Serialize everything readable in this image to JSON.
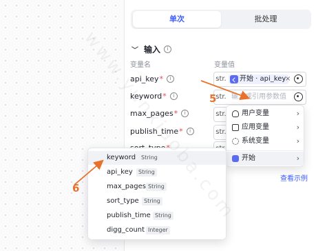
{
  "tabs": [
    {
      "label": "单次"
    },
    {
      "label": "批处理"
    }
  ],
  "section": {
    "title": "输入"
  },
  "columns": {
    "name": "变量名",
    "value": "变量值"
  },
  "rows": [
    {
      "name": "api_key",
      "required": "*",
      "type": "str.",
      "chip": "开始 · api_key"
    },
    {
      "name": "keyword",
      "required": "*",
      "type": "str.",
      "placeholder": "输入或引用参数值"
    },
    {
      "name": "max_pages",
      "required": "*",
      "type": "str."
    },
    {
      "name": "publish_time",
      "required": "*",
      "type": "str."
    },
    {
      "name": "sort_type",
      "required": "*",
      "type": "str."
    }
  ],
  "ref_menu": {
    "items": [
      {
        "label": "用户变量",
        "icon": "user-icon"
      },
      {
        "label": "应用变量",
        "icon": "folder-icon"
      },
      {
        "label": "系统变量",
        "icon": "gear-icon"
      },
      {
        "label": "开始",
        "icon": "start-node-icon"
      }
    ]
  },
  "picker": {
    "items": [
      {
        "name": "keyword",
        "type": "String"
      },
      {
        "name": "api_key",
        "type": "String"
      },
      {
        "name": "max_pages",
        "type": "String"
      },
      {
        "name": "sort_type",
        "type": "String"
      },
      {
        "name": "publish_time",
        "type": "String"
      },
      {
        "name": "digg_count",
        "type": "Integer"
      }
    ]
  },
  "sample_link": "查看示例",
  "annotations": {
    "step5": "5",
    "step6": "6"
  },
  "watermark": "www.yunxiaoba.com",
  "colors": {
    "accent": "#3b5bff",
    "arrow": "#e8722c",
    "required": "#e5484d"
  }
}
